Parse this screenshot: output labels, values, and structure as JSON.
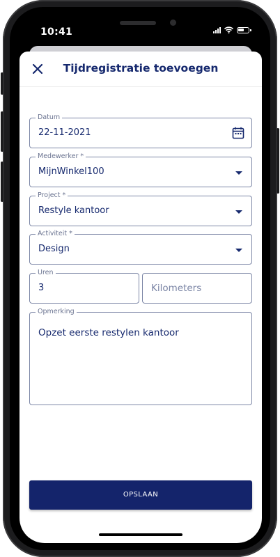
{
  "status_bar": {
    "time": "10:41"
  },
  "header": {
    "title": "Tijdregistratie toevoegen",
    "close_icon": "close-icon"
  },
  "form": {
    "datum": {
      "label": "Datum",
      "value": "22-11-2021",
      "icon": "calendar-icon"
    },
    "medewerker": {
      "label": "Medewerker *",
      "value": "MijnWinkel100"
    },
    "project": {
      "label": "Project *",
      "value": "Restyle kantoor"
    },
    "activiteit": {
      "label": "Activiteit *",
      "value": "Design"
    },
    "uren": {
      "label": "Uren",
      "value": "3"
    },
    "kilometers": {
      "placeholder": "Kilometers"
    },
    "opmerking": {
      "label": "Opmerking",
      "value": "Opzet eerste restylen kantoor"
    }
  },
  "actions": {
    "save_label": "OPSLAAN"
  },
  "colors": {
    "primary": "#16296e",
    "button": "#14246b",
    "border": "#7c86a6"
  }
}
